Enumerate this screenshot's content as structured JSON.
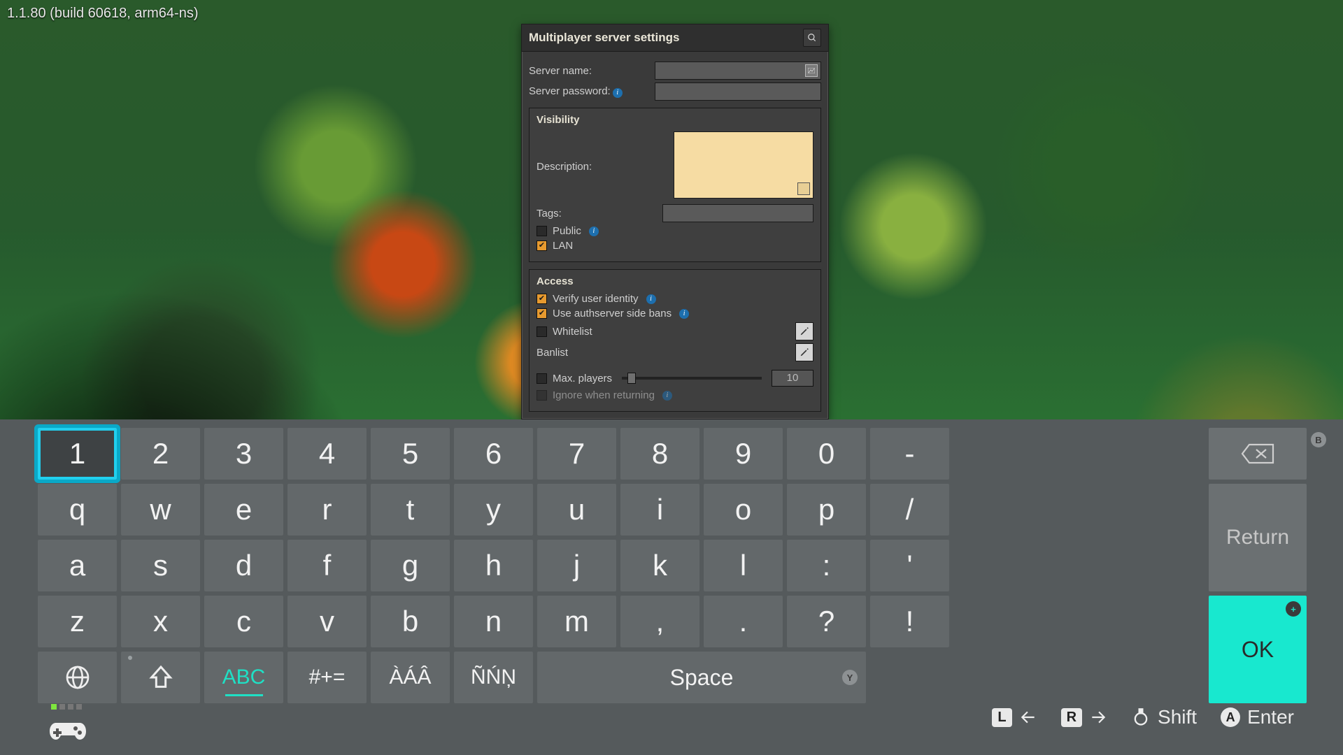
{
  "version": "1.1.80 (build 60618, arm64-ns)",
  "dialog": {
    "title": "Multiplayer server settings",
    "server_name_label": "Server name:",
    "server_password_label": "Server password:",
    "visibility_header": "Visibility",
    "description_label": "Description:",
    "tags_label": "Tags:",
    "public_label": "Public",
    "public_checked": false,
    "lan_label": "LAN",
    "lan_checked": true,
    "access_header": "Access",
    "verify_label": "Verify user identity",
    "verify_checked": true,
    "authbans_label": "Use authserver side bans",
    "authbans_checked": true,
    "whitelist_label": "Whitelist",
    "whitelist_checked": false,
    "banlist_label": "Banlist",
    "maxplayers_label": "Max. players",
    "maxplayers_checked": false,
    "maxplayers_value": "10",
    "ignore_label": "Ignore when returning",
    "ignore_checked": false
  },
  "keyboard": {
    "row1": [
      "1",
      "2",
      "3",
      "4",
      "5",
      "6",
      "7",
      "8",
      "9",
      "0",
      "-"
    ],
    "row2": [
      "q",
      "w",
      "e",
      "r",
      "t",
      "y",
      "u",
      "i",
      "o",
      "p",
      "/"
    ],
    "row3": [
      "a",
      "s",
      "d",
      "f",
      "g",
      "h",
      "j",
      "k",
      "l",
      ":",
      "'"
    ],
    "row4": [
      "z",
      "x",
      "c",
      "v",
      "b",
      "n",
      "m",
      ",",
      ".",
      "?",
      "!"
    ],
    "abc": "ABC",
    "sym": "#+=",
    "acc1": "ÀÁÂ",
    "acc2": "ÑŃŅ",
    "space": "Space",
    "return": "Return",
    "ok": "OK",
    "selected": "1",
    "badge_bksp": "B",
    "badge_ok": "+",
    "badge_space": "Y"
  },
  "hints": {
    "l": "L",
    "r": "R",
    "shift": "Shift",
    "enter": "Enter",
    "a": "A"
  }
}
